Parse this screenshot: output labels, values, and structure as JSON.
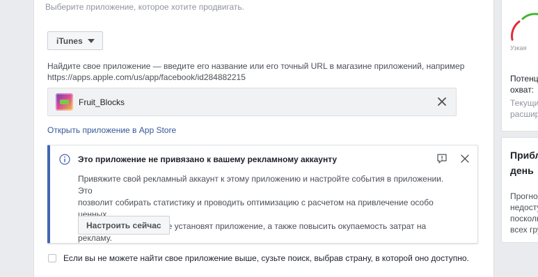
{
  "main": {
    "subtitle": "Выберите приложение, которое хотите продвигать.",
    "store_select": {
      "value": "iTunes"
    },
    "hint_line1": "Найдите свое приложение — введите его название или его точный URL в магазине приложений, например",
    "hint_line2": "https://apps.apple.com/us/app/facebook/id284882215",
    "selected_app": {
      "name": "Fruit_Blocks"
    },
    "store_link": "Открыть приложение в App Store",
    "notice": {
      "title": "Это приложение не привязано к вашему рекламному аккаунту",
      "body_line1": "Привяжите свой рекламный аккаунт к этому приложению и настройте события в приложении. Это",
      "body_line2": "позволит собирать статистику и проводить оптимизацию с расчетом на привлечение особо ценных",
      "body_line3": "пользователей, которые установят приложение, а также повысить окупаемость затрат на рекламу.",
      "action_label": "Настроить сейчас"
    },
    "country_checkbox_label": "Если вы не можете найти свое приложение выше, сузьте поиск, выбрав страну, в которой оно доступно."
  },
  "sidebar": {
    "gauge_label": "Узкая",
    "audience_label_line1": "Потенц",
    "audience_label_line2": "охват:",
    "current_line1": "Текущи",
    "current_line2": "расшир",
    "daily_title_line1": "Прибл",
    "daily_title_line2": "день",
    "daily_text_line1": "Прогноз",
    "daily_text_line2": "недосту",
    "daily_text_line3": "посколь",
    "daily_text_line4": "всех гру"
  },
  "colors": {
    "link": "#365899",
    "accent": "#4267b2",
    "gauge_red": "#e02d3c",
    "gauge_green": "#42b72a"
  }
}
